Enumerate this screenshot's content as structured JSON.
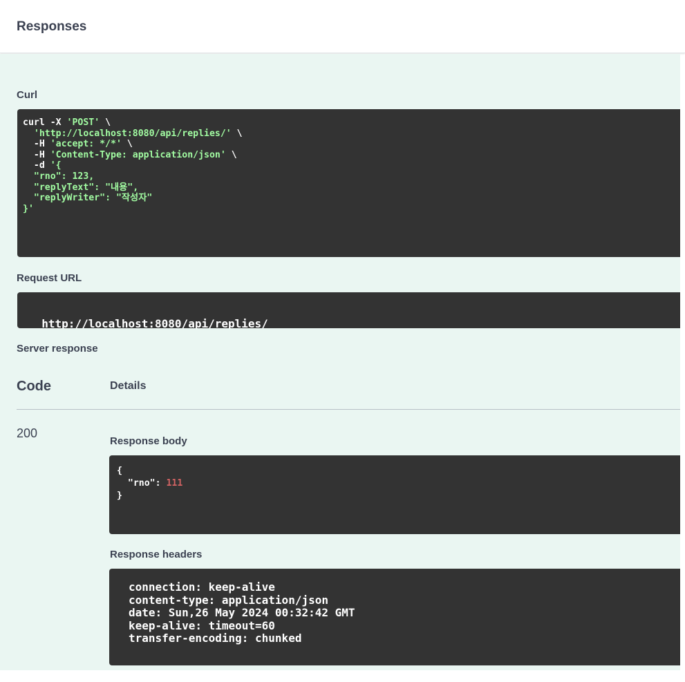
{
  "responses": {
    "title": "Responses"
  },
  "curl": {
    "label": "Curl",
    "lines": [
      [
        "curl -X ",
        "'POST'",
        " \\"
      ],
      [
        "  ",
        "'http://localhost:8080/api/replies/'",
        " \\"
      ],
      [
        "  -H ",
        "'accept: */*'",
        " \\"
      ],
      [
        "  -H ",
        "'Content-Type: application/json'",
        " \\"
      ],
      [
        "  -d ",
        "'{",
        ""
      ],
      [
        "  ",
        "\"rno\": 123,",
        ""
      ],
      [
        "  ",
        "\"replyText\": \"내용\",",
        ""
      ],
      [
        "  ",
        "\"replyWriter\": \"작성자\"",
        ""
      ],
      [
        "",
        "}'",
        ""
      ]
    ]
  },
  "request_url": {
    "label": "Request URL",
    "value": "http://localhost:8080/api/replies/"
  },
  "server_response": {
    "label": "Server response",
    "code_header": "Code",
    "details_header": "Details",
    "status_code": "200",
    "response_body": {
      "label": "Response body",
      "open": "{",
      "key": "\"rno\"",
      "sep": ": ",
      "value": "111",
      "close": "}"
    },
    "response_headers": {
      "label": "Response headers",
      "lines": [
        "connection: keep-alive",
        "content-type: application/json",
        "date: Sun,26 May 2024 00:32:42 GMT",
        "keep-alive: timeout=60",
        "transfer-encoding: chunked"
      ]
    }
  },
  "colors": {
    "panel_bg": "#eaf6f2",
    "code_bg": "#333333",
    "string_green": "#a2fca2",
    "number_red": "#d36363"
  }
}
